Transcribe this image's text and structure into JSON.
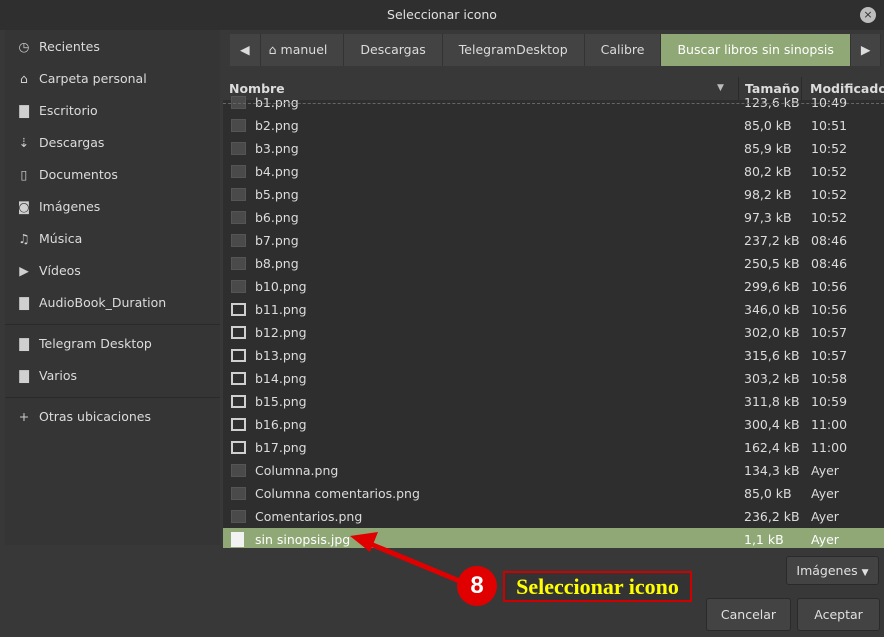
{
  "window": {
    "title": "Seleccionar icono",
    "close": "×"
  },
  "sidebar": {
    "items": [
      {
        "label": "Recientes",
        "icon": "clock-icon",
        "glyph": "◷"
      },
      {
        "label": "Carpeta personal",
        "icon": "home-icon",
        "glyph": "⌂"
      },
      {
        "label": "Escritorio",
        "icon": "folder-icon",
        "glyph": "▇"
      },
      {
        "label": "Descargas",
        "icon": "download-icon",
        "glyph": "⇣"
      },
      {
        "label": "Documentos",
        "icon": "document-icon",
        "glyph": "▯"
      },
      {
        "label": "Imágenes",
        "icon": "camera-icon",
        "glyph": "◙"
      },
      {
        "label": "Música",
        "icon": "music-icon",
        "glyph": "♫"
      },
      {
        "label": "Vídeos",
        "icon": "video-icon",
        "glyph": "▶"
      },
      {
        "label": "AudioBook_Duration",
        "icon": "folder-icon",
        "glyph": "▇"
      },
      {
        "label": "Telegram Desktop",
        "icon": "folder-icon",
        "glyph": "▇"
      },
      {
        "label": "Varios",
        "icon": "folder-icon",
        "glyph": "▇"
      },
      {
        "label": "Otras ubicaciones",
        "icon": "plus-icon",
        "glyph": "+"
      }
    ]
  },
  "pathbar": {
    "back": "◀",
    "forward": "▶",
    "crumbs": [
      "manuel",
      "Descargas",
      "TelegramDesktop",
      "Calibre",
      "Buscar libros sin sinopsis"
    ]
  },
  "columns": {
    "name": "Nombre",
    "size": "Tamaño",
    "modified": "Modificado"
  },
  "files": [
    {
      "name": "b1.png",
      "size": "123,6 kB",
      "time": "10:49",
      "icon": "thumb"
    },
    {
      "name": "b2.png",
      "size": "85,0 kB",
      "time": "10:51",
      "icon": "thumb"
    },
    {
      "name": "b3.png",
      "size": "85,9 kB",
      "time": "10:52",
      "icon": "thumb"
    },
    {
      "name": "b4.png",
      "size": "80,2 kB",
      "time": "10:52",
      "icon": "thumb"
    },
    {
      "name": "b5.png",
      "size": "98,2 kB",
      "time": "10:52",
      "icon": "thumb"
    },
    {
      "name": "b6.png",
      "size": "97,3 kB",
      "time": "10:52",
      "icon": "thumb"
    },
    {
      "name": "b7.png",
      "size": "237,2 kB",
      "time": "08:46",
      "icon": "thumb"
    },
    {
      "name": "b8.png",
      "size": "250,5 kB",
      "time": "08:46",
      "icon": "thumb"
    },
    {
      "name": "b10.png",
      "size": "299,6 kB",
      "time": "10:56",
      "icon": "thumb"
    },
    {
      "name": "b11.png",
      "size": "346,0 kB",
      "time": "10:56",
      "icon": "frame"
    },
    {
      "name": "b12.png",
      "size": "302,0 kB",
      "time": "10:57",
      "icon": "frame"
    },
    {
      "name": "b13.png",
      "size": "315,6 kB",
      "time": "10:57",
      "icon": "frame"
    },
    {
      "name": "b14.png",
      "size": "303,2 kB",
      "time": "10:58",
      "icon": "frame"
    },
    {
      "name": "b15.png",
      "size": "311,8 kB",
      "time": "10:59",
      "icon": "frame"
    },
    {
      "name": "b16.png",
      "size": "300,4 kB",
      "time": "11:00",
      "icon": "frame"
    },
    {
      "name": "b17.png",
      "size": "162,4 kB",
      "time": "11:00",
      "icon": "frame"
    },
    {
      "name": "Columna.png",
      "size": "134,3 kB",
      "time": "Ayer",
      "icon": "thumb"
    },
    {
      "name": "Columna comentarios.png",
      "size": "85,0 kB",
      "time": "Ayer",
      "icon": "thumb"
    },
    {
      "name": "Comentarios.png",
      "size": "236,2 kB",
      "time": "Ayer",
      "icon": "thumb"
    },
    {
      "name": "sin sinopsis.jpg",
      "size": "1,1 kB",
      "time": "Ayer",
      "icon": "blank",
      "selected": true
    }
  ],
  "filter": {
    "label": "Imágenes"
  },
  "buttons": {
    "cancel": "Cancelar",
    "accept": "Aceptar"
  },
  "annotation": {
    "step": "8",
    "label": "Seleccionar icono"
  },
  "colors": {
    "accent": "#8fa876",
    "annotation": "#e00000",
    "annotation_text": "#ffff00"
  }
}
